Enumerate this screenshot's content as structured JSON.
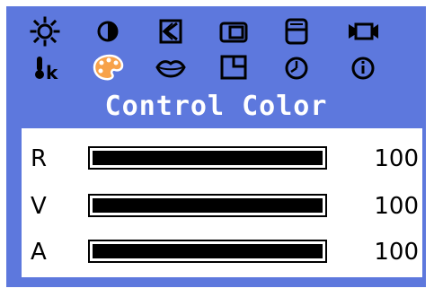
{
  "osd": {
    "title": "Control Color",
    "menu_icons_row1": [
      {
        "icon": "sun-brightness-icon"
      },
      {
        "icon": "half-circle-contrast-icon"
      },
      {
        "icon": "position-arrow-icon"
      },
      {
        "icon": "size-icon"
      },
      {
        "icon": "osd-menu-icon"
      },
      {
        "icon": "video-camera-icon"
      }
    ],
    "menu_icons_row2": [
      {
        "icon": "thermometer-k-icon",
        "label": "k"
      },
      {
        "icon": "palette-color-icon",
        "selected": true
      },
      {
        "icon": "lips-icon"
      },
      {
        "icon": "window-corner-icon"
      },
      {
        "icon": "clock-icon"
      },
      {
        "icon": "info-icon"
      }
    ],
    "sliders": [
      {
        "label": "R",
        "value": "100",
        "level": 1.0
      },
      {
        "label": "V",
        "value": "100",
        "level": 1.0
      },
      {
        "label": "A",
        "value": "100",
        "level": 1.0
      }
    ],
    "colors": {
      "background": "#5d78dd",
      "panel": "#ffffff",
      "selected_icon": "#f7a24a",
      "text": "#000000",
      "title_text": "#ffffff"
    }
  }
}
